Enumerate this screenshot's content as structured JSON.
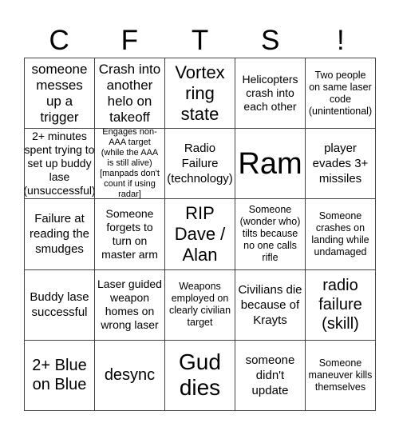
{
  "header": {
    "letters": [
      "C",
      "F",
      "T",
      "S",
      "!"
    ]
  },
  "cells": [
    "someone messes up a trigger",
    "Crash into another helo on takeoff",
    "Vortex ring state",
    "Helicopters crash into each other",
    "Two people on same laser code (unintentional)",
    "2+ minutes spent trying to set up buddy lase (unsuccessful)",
    "Engages non-AAA target (while the AAA is still alive) [manpads don't count if using radar]",
    "Radio Failure (technology)",
    "Ram",
    "player evades 3+ missiles",
    "Failure at reading the smudges",
    "Someone forgets to turn on master arm",
    "RIP Dave / Alan",
    "Someone (wonder who) tilts because no one calls rifle",
    "Someone crashes on landing while undamaged",
    "Buddy lase successful",
    "Laser guided weapon homes on wrong laser",
    "Weapons employed on clearly civilian target",
    "Civilians die because of Krayts",
    "radio failure (skill)",
    "2+ Blue on Blue",
    "desync",
    "Gud dies",
    "someone didn't update",
    "Someone maneuver kills themselves"
  ]
}
